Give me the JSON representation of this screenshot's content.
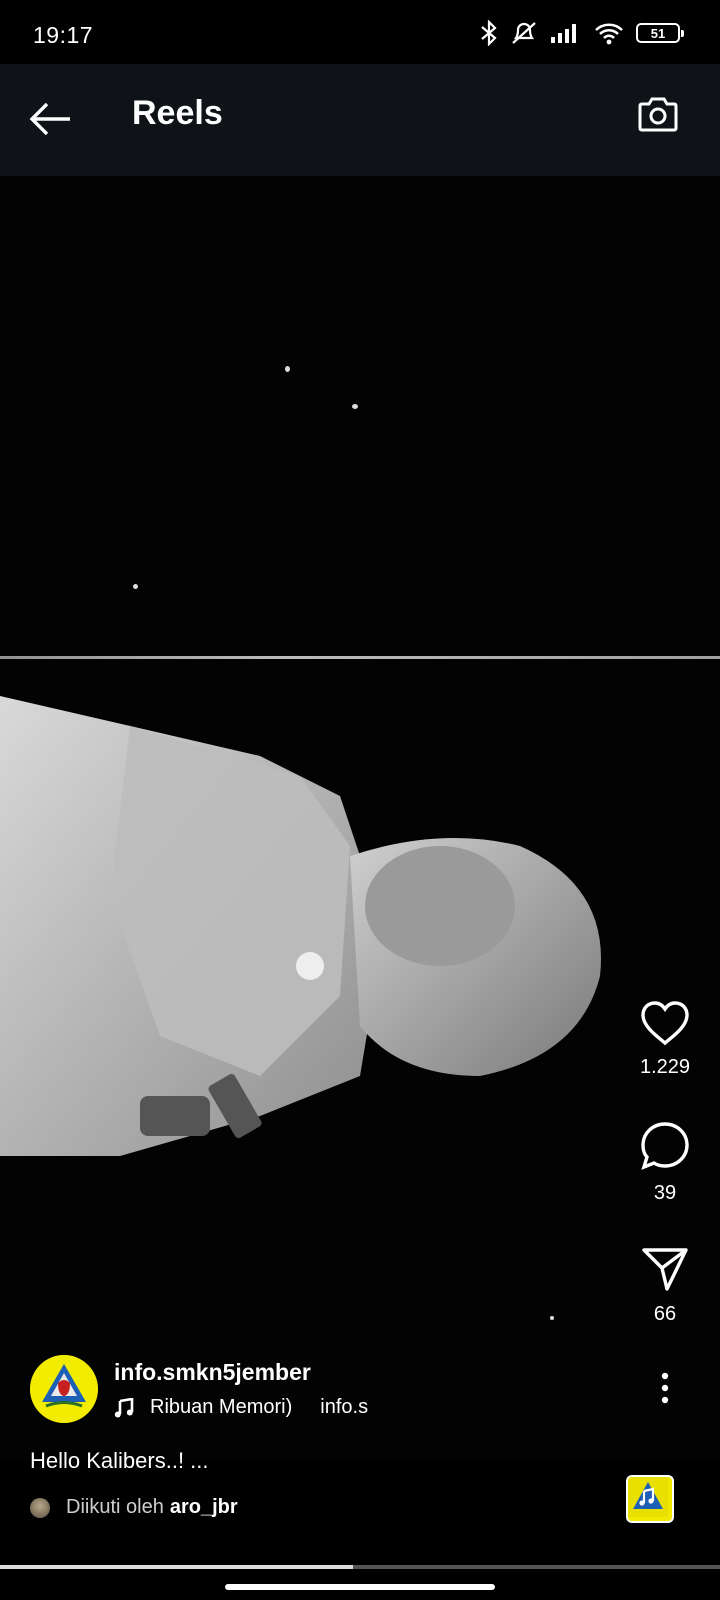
{
  "status_bar": {
    "time": "19:17",
    "battery": "51",
    "icons": [
      "bluetooth-icon",
      "mute-icon",
      "signal-icon",
      "wifi-icon",
      "battery-icon"
    ]
  },
  "header": {
    "title": "Reels",
    "back_icon": "arrow-left-icon",
    "camera_icon": "camera-icon"
  },
  "actions": {
    "likes": "1.229",
    "comments": "39",
    "shares": "66"
  },
  "post": {
    "username": "info.smkn5jember",
    "audio_text": "Ribuan Memori)",
    "audio_credit": "info.s",
    "caption": "Hello Kalibers..! ...",
    "followed_prefix": "Diikuti oleh",
    "followed_user": "aro_jbr"
  },
  "progress": {
    "fraction": 0.49
  }
}
